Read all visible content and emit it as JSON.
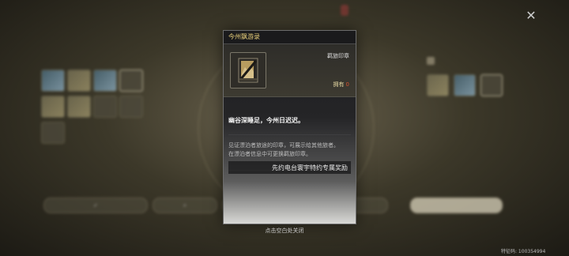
{
  "dialog": {
    "header": "今州飘游录",
    "item_type": "羁旅印章",
    "owned_label": "拥有",
    "owned_count": "0",
    "flavor_text": "幽谷深睡足，今州日迟迟。",
    "description_lines": [
      "见证漂泊者旅途的印章，可展示给其他旅者。",
      "在漂泊者信息中可更换羁旅印章。"
    ],
    "source": "先约电台寰宇特约专属奖励"
  },
  "hint": "点击空白处关闭",
  "footer": {
    "uid": "特征码: 100354994"
  },
  "colors": {
    "header_text": "#e8cf7a",
    "owned_count": "#d4522e"
  },
  "icons": [
    "close-icon",
    "stamp-icon",
    "checkmark-icon",
    "search-icon"
  ]
}
